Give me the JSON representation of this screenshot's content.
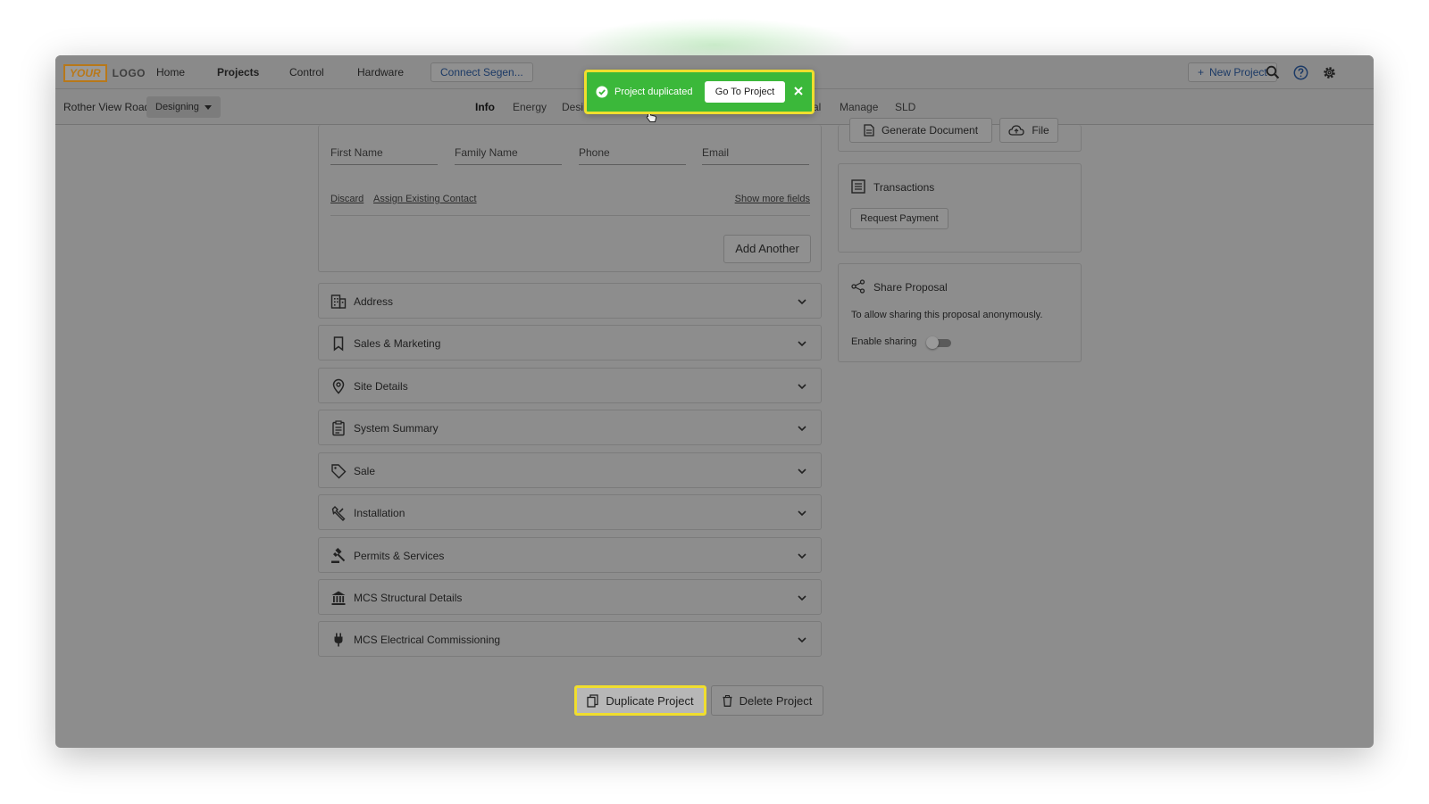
{
  "brand": {
    "logo_box": "YOUR",
    "logo_text": "LOGO"
  },
  "topnav": {
    "items": [
      "Home",
      "Projects",
      "Control",
      "Hardware"
    ],
    "active": "Projects",
    "connect_label": "Connect Segen...",
    "new_project_label": "New Project",
    "icons": [
      "search-icon",
      "help-icon",
      "settings-icon"
    ]
  },
  "subnav": {
    "project_name": "Rother View Road",
    "status": "Designing",
    "tabs": [
      "Info",
      "Energy",
      "Desi",
      "al",
      "Manage",
      "SLD"
    ],
    "active_tab": "Info"
  },
  "contact_form": {
    "fields": [
      "First Name",
      "Family Name",
      "Phone",
      "Email"
    ],
    "discard": "Discard",
    "assign_existing": "Assign Existing Contact",
    "show_more": "Show more fields",
    "add_another": "Add Another"
  },
  "sections": [
    {
      "label": "Address",
      "icon": "building-icon"
    },
    {
      "label": "Sales & Marketing",
      "icon": "bookmark-icon"
    },
    {
      "label": "Site Details",
      "icon": "location-pin-icon"
    },
    {
      "label": "System Summary",
      "icon": "clipboard-icon"
    },
    {
      "label": "Sale",
      "icon": "tag-icon"
    },
    {
      "label": "Installation",
      "icon": "wrench-icon"
    },
    {
      "label": "Permits & Services",
      "icon": "gavel-icon"
    },
    {
      "label": "MCS Structural Details",
      "icon": "institution-icon"
    },
    {
      "label": "MCS Electrical Commissioning",
      "icon": "plug-icon"
    }
  ],
  "documents": {
    "generate_label": "Generate Document",
    "file_label": "File"
  },
  "transactions": {
    "title": "Transactions",
    "request_payment": "Request Payment"
  },
  "share": {
    "title": "Share Proposal",
    "description": "To allow sharing this proposal anonymously.",
    "enable_label": "Enable sharing",
    "enabled": false
  },
  "actions": {
    "duplicate": "Duplicate Project",
    "delete": "Delete Project"
  },
  "toast": {
    "message": "Project duplicated",
    "action": "Go To Project"
  },
  "colors": {
    "toast_bg": "#3bb83a",
    "highlight": "#f0de2e",
    "link": "#1c3a66",
    "logo": "#b8781a"
  }
}
